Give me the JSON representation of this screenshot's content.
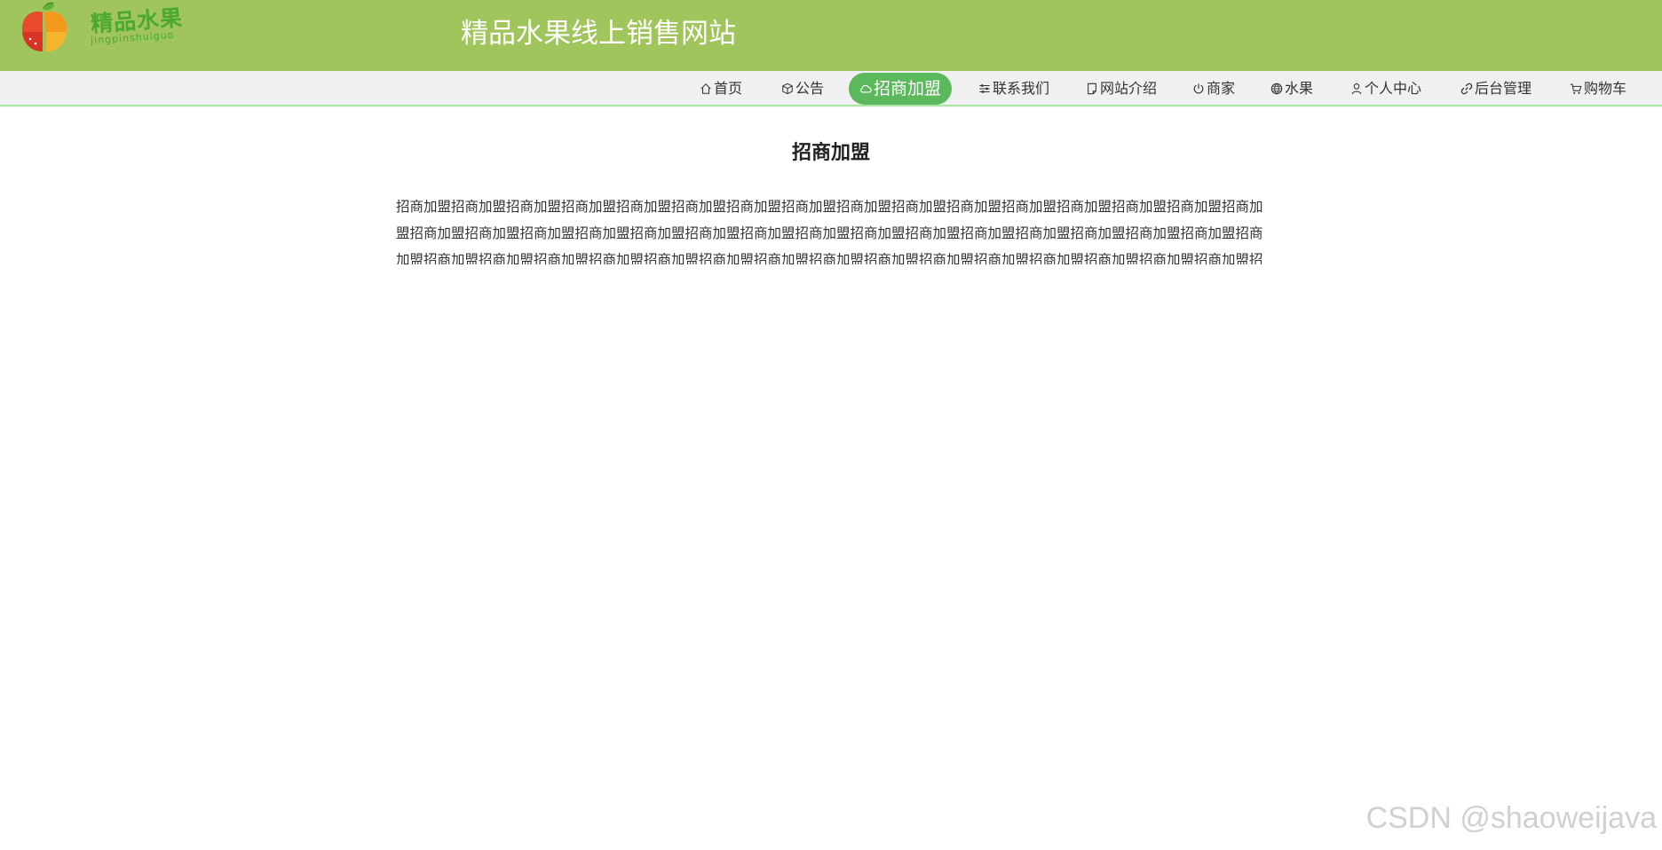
{
  "header": {
    "logo": {
      "text": "精品水果",
      "subtext": "jingpinshuiguo"
    },
    "title": "精品水果线上销售网站",
    "background_color": "#9fc55c"
  },
  "nav": {
    "accent_color": "#5cb85c",
    "items": [
      {
        "label": "首页",
        "icon": "home-icon"
      },
      {
        "label": "公告",
        "icon": "cube-icon"
      },
      {
        "label": "招商加盟",
        "icon": "cloud-icon",
        "active": true
      },
      {
        "label": "联系我们",
        "icon": "sliders-icon"
      },
      {
        "label": "网站介绍",
        "icon": "document-icon"
      },
      {
        "label": "商家",
        "icon": "power-icon"
      },
      {
        "label": "水果",
        "icon": "globe-icon"
      },
      {
        "label": "个人中心",
        "icon": "user-icon"
      },
      {
        "label": "后台管理",
        "icon": "link-icon"
      },
      {
        "label": "购物车",
        "icon": "cart-icon"
      }
    ]
  },
  "content": {
    "title": "招商加盟",
    "body": "招商加盟招商加盟招商加盟招商加盟招商加盟招商加盟招商加盟招商加盟招商加盟招商加盟招商加盟招商加盟招商加盟招商加盟招商加盟招商加盟招商加盟招商加盟招商加盟招商加盟招商加盟招商加盟招商加盟招商加盟招商加盟招商加盟招商加盟招商加盟招商加盟招商加盟招商加盟招商加盟招商加盟招商加盟招商加盟招商加盟招商加盟招商加盟招商加盟招商加盟招商加盟招商加盟招商加盟招商加盟招商加盟招商加盟招商加盟招商加盟招商加盟"
  },
  "watermark": "CSDN @shaoweijava"
}
